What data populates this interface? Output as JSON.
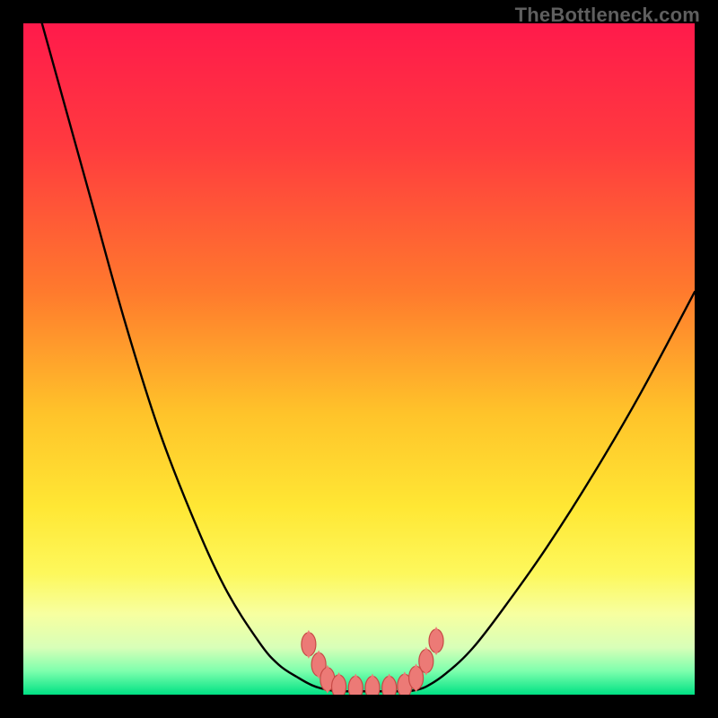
{
  "watermark": "TheBottleneck.com",
  "chart_data": {
    "type": "line",
    "title": "",
    "xlabel": "",
    "ylabel": "",
    "xlim": [
      0,
      100
    ],
    "ylim": [
      0,
      100
    ],
    "gradient_stops": [
      {
        "offset": 0,
        "color": "#ff1a4b"
      },
      {
        "offset": 0.18,
        "color": "#ff3a3f"
      },
      {
        "offset": 0.4,
        "color": "#ff7a2d"
      },
      {
        "offset": 0.58,
        "color": "#ffc32a"
      },
      {
        "offset": 0.72,
        "color": "#ffe734"
      },
      {
        "offset": 0.82,
        "color": "#fdf85c"
      },
      {
        "offset": 0.88,
        "color": "#f7ffa0"
      },
      {
        "offset": 0.93,
        "color": "#d8ffb8"
      },
      {
        "offset": 0.965,
        "color": "#7dffad"
      },
      {
        "offset": 1.0,
        "color": "#00e184"
      }
    ],
    "series": [
      {
        "name": "curve-left",
        "type": "line",
        "x": [
          0,
          5,
          10,
          15,
          20,
          25,
          30,
          35,
          38,
          41,
          43,
          44.5,
          46
        ],
        "y": [
          110,
          92,
          74,
          56,
          40,
          27,
          16,
          8,
          4.5,
          2.5,
          1.4,
          0.9,
          0.6
        ]
      },
      {
        "name": "curve-right",
        "type": "line",
        "x": [
          58,
          60,
          63,
          67,
          72,
          78,
          85,
          92,
          100
        ],
        "y": [
          0.6,
          1.2,
          3.2,
          7.0,
          13.5,
          22.0,
          33.0,
          45.0,
          60.0
        ]
      },
      {
        "name": "flat-zone",
        "type": "line",
        "x": [
          46,
          48,
          50,
          52,
          54,
          56,
          58
        ],
        "y": [
          0.6,
          0.5,
          0.5,
          0.5,
          0.5,
          0.5,
          0.6
        ]
      }
    ],
    "markers": {
      "name": "bottleneck-markers",
      "shape": "lozenge",
      "fill": "#ec7a76",
      "stroke": "#c74a46",
      "points": [
        {
          "x": 42.5,
          "y": 7.5
        },
        {
          "x": 44.0,
          "y": 4.5
        },
        {
          "x": 45.3,
          "y": 2.3
        },
        {
          "x": 47.0,
          "y": 1.2
        },
        {
          "x": 49.5,
          "y": 1.0
        },
        {
          "x": 52.0,
          "y": 1.0
        },
        {
          "x": 54.5,
          "y": 1.0
        },
        {
          "x": 56.8,
          "y": 1.3
        },
        {
          "x": 58.5,
          "y": 2.5
        },
        {
          "x": 60.0,
          "y": 5.0
        },
        {
          "x": 61.5,
          "y": 8.0
        }
      ]
    }
  }
}
